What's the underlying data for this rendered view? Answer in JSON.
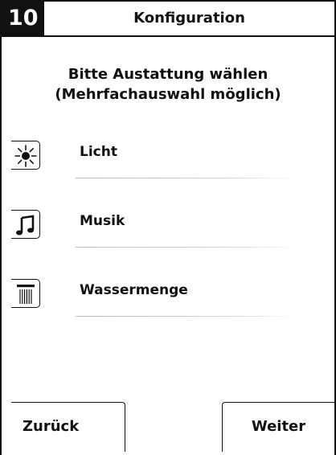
{
  "header": {
    "step": "10",
    "title": "Konfiguration"
  },
  "instruction": {
    "line1": "Bitte Austattung wählen",
    "line2": "(Mehrfachauswahl möglich)"
  },
  "options": [
    {
      "label": "Licht",
      "icon": "sun-icon"
    },
    {
      "label": "Musik",
      "icon": "music-note-icon"
    },
    {
      "label": "Wassermenge",
      "icon": "shower-icon"
    }
  ],
  "footer": {
    "back_label": "Zurück",
    "next_label": "Weiter"
  }
}
